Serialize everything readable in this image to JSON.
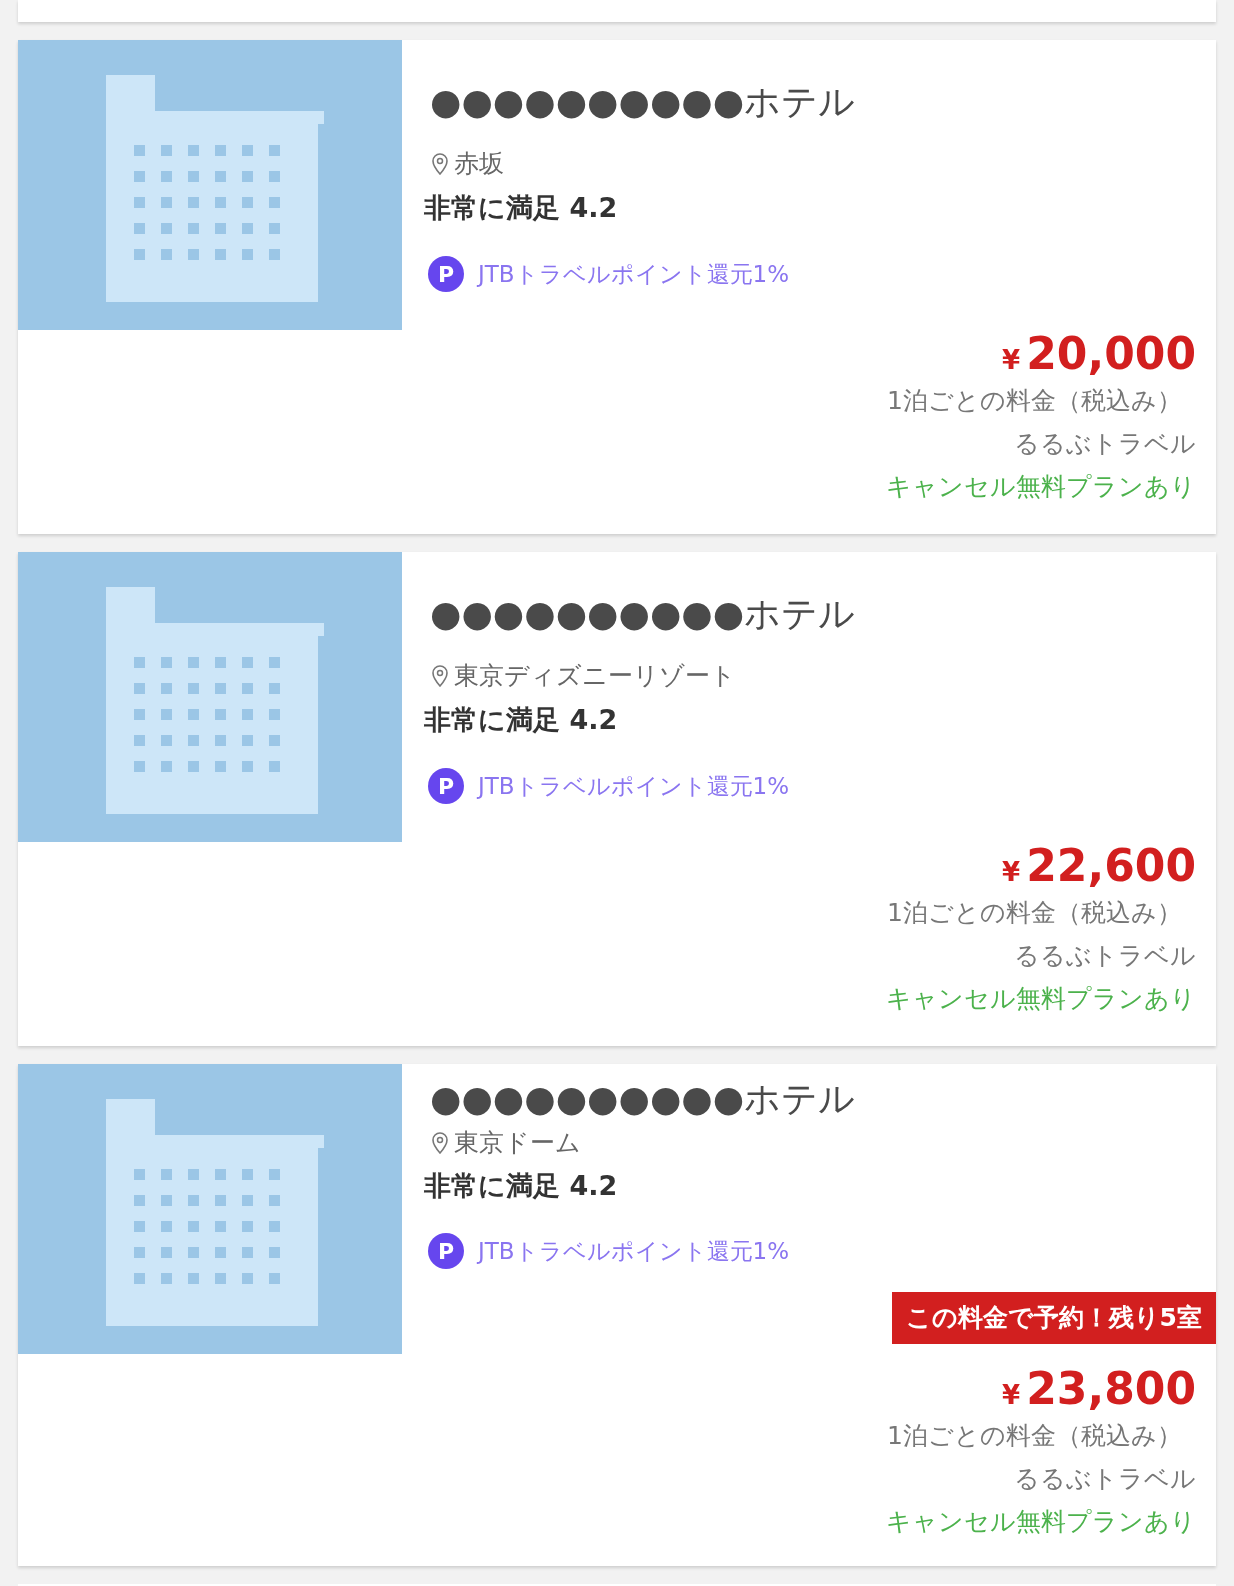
{
  "hotels": [
    {
      "name": "●●●●●●●●●●ホテル",
      "location": "赤坂",
      "rating": "非常に満足 4.2",
      "points": "JTBトラベルポイント還元1%",
      "points_icon": "P",
      "currency": "¥",
      "price": "20,000",
      "price_note": "1泊ごとの料金（税込み）",
      "provider": "るるぶトラベル",
      "cancel_note": "キャンセル無料プランあり"
    },
    {
      "name": "●●●●●●●●●●ホテル",
      "location": "東京ディズニーリゾート",
      "rating": "非常に満足 4.2",
      "points": "JTBトラベルポイント還元1%",
      "points_icon": "P",
      "currency": "¥",
      "price": "22,600",
      "price_note": "1泊ごとの料金（税込み）",
      "provider": "るるぶトラベル",
      "cancel_note": "キャンセル無料プランあり"
    },
    {
      "name": "●●●●●●●●●●ホテル",
      "location": "東京ドーム",
      "rating": "非常に満足 4.2",
      "points": "JTBトラベルポイント還元1%",
      "points_icon": "P",
      "badge": "この料金で予約！残り5室",
      "currency": "¥",
      "price": "23,800",
      "price_note": "1泊ごとの料金（税込み）",
      "provider": "るるぶトラベル",
      "cancel_note": "キャンセル無料プランあり"
    }
  ]
}
